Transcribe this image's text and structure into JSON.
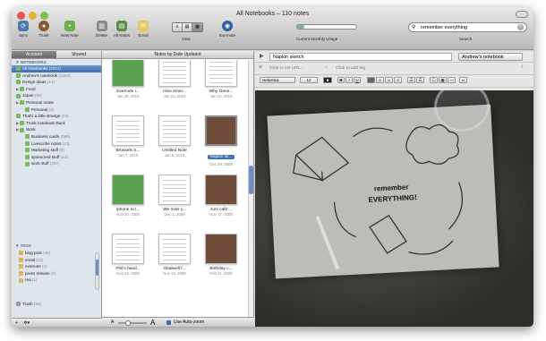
{
  "window": {
    "title": "All Notebooks – 110 notes"
  },
  "toolbar": {
    "buttons": [
      {
        "label": "Sync",
        "icon": "sync-icon"
      },
      {
        "label": "Trunk",
        "icon": "trunk-icon"
      },
      {
        "label": "New Note",
        "icon": "new-note-icon"
      },
      {
        "label": "Delete",
        "icon": "trash-icon"
      },
      {
        "label": "All Notes",
        "icon": "all-notes-icon"
      },
      {
        "label": "Email",
        "icon": "email-icon"
      }
    ],
    "view_label": "View",
    "evernote_label": "Evernote",
    "usage_label": "Current Monthly Usage",
    "usage_fraction": 0.12,
    "search_value": "remember everything",
    "search_label": "Search"
  },
  "sidebar": {
    "tabs": [
      "Account",
      "Shared"
    ],
    "notebooks_header": "▼ NOTEBOOKS",
    "notebooks": [
      {
        "name": "All Notebooks",
        "count": "(2821)",
        "selected": true,
        "indent": 0
      },
      {
        "name": "Andrew's notebook",
        "count": "(1453)",
        "indent": 0
      },
      {
        "name": "Design ideas",
        "count": "(14)",
        "indent": 0
      },
      {
        "name": "Food",
        "count": "",
        "indent": 0,
        "group": true
      },
      {
        "name": "Japan",
        "count": "(93)",
        "indent": 0
      },
      {
        "name": "Personal notes",
        "count": "",
        "indent": 0,
        "group": true
      },
      {
        "name": "Personal",
        "count": "(2)",
        "indent": 1
      },
      {
        "name": "That's a little strange",
        "count": "(32)",
        "indent": 0
      },
      {
        "name": "Trunk notebook stack",
        "count": "",
        "indent": 0,
        "group": true
      },
      {
        "name": "Work",
        "count": "",
        "indent": 0,
        "group": true
      },
      {
        "name": "Business cards",
        "count": "(589)",
        "indent": 1
      },
      {
        "name": "Livescribe notes",
        "count": "(13)",
        "indent": 1
      },
      {
        "name": "Marketing stuff",
        "count": "(5)",
        "indent": 1
      },
      {
        "name": "sponsored stuff",
        "count": "(13)",
        "indent": 1
      },
      {
        "name": "work stuff",
        "count": "(287)",
        "indent": 1
      }
    ],
    "tags_header": "▼ TAGS",
    "tags": [
      {
        "name": "blog post",
        "count": "(45)"
      },
      {
        "name": "email",
        "count": "(11)"
      },
      {
        "name": "evernote",
        "count": "(3)"
      },
      {
        "name": "press release",
        "count": "(2)"
      },
      {
        "name": "rea",
        "count": "(1)"
      }
    ],
    "trash": {
      "name": "Trash",
      "count": "(38)"
    },
    "footer_add": "+",
    "footer_gear": "✲▾"
  },
  "notes": {
    "header": "Notes by Date Updated",
    "cards": [
      {
        "title": "Evernote i...",
        "date": "Jan 29, 2010"
      },
      {
        "title": "How Amer...",
        "date": "Jan 21, 2010"
      },
      {
        "title": "Why Gene...",
        "date": "Jan 10, 2010"
      },
      {
        "title": "Brussels S...",
        "date": "Jan 7, 2010"
      },
      {
        "title": "Untitled Note",
        "date": "Jan 6, 2010"
      },
      {
        "title": "Napkin sk...",
        "date": "Dec 29, 2009",
        "selected": true
      },
      {
        "title": "iphone scr...",
        "date": "Nov 30, 2009"
      },
      {
        "title": "We miss y...",
        "date": "Dec 1, 2009"
      },
      {
        "title": "zuni cafe'...",
        "date": "Nov 17, 2009"
      },
      {
        "title": "Phil's head...",
        "date": "Nov 23, 2009"
      },
      {
        "title": "Gladwell f...",
        "date": "Nov 12, 2009"
      },
      {
        "title": "Birthday c...",
        "date": "Feb 11, 2009"
      }
    ],
    "zoom_small": "A",
    "zoom_large": "A",
    "autozoom_label": "Use Auto-zoom"
  },
  "editor": {
    "title_value": "Napkin sketch",
    "notebook": "Andrew's notebook",
    "url_placeholder": "Click to set URL...",
    "tag_placeholder": "Click to add tag",
    "font": "Helvetica",
    "font_size": "12",
    "bold": "B",
    "italic": "I",
    "underline": "U",
    "napkin_text_1": "remember",
    "napkin_text_2": "EVERYTHING!"
  }
}
